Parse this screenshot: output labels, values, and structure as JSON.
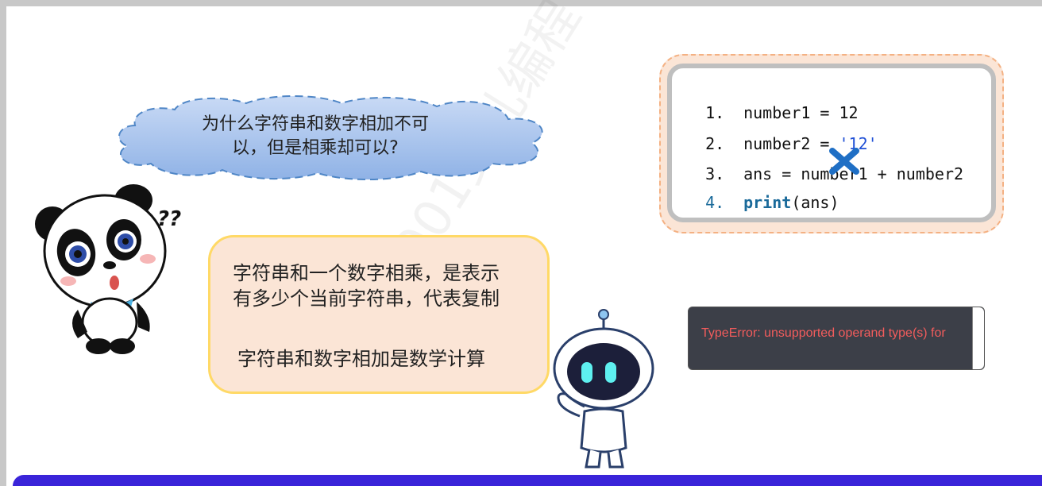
{
  "cloud": {
    "question_line1": "为什么字符串和数字相加不可",
    "question_line2": "以，但是相乘却可以?"
  },
  "panda": {
    "question_marks": "??"
  },
  "note": {
    "line1": "字符串和一个数字相乘，是表示",
    "line2": "有多少个当前字符串，代表复制",
    "line3": "字符串和数字相加是数学计算"
  },
  "code": {
    "lines": [
      {
        "num": "1.",
        "text": "number1 = 12"
      },
      {
        "num": "2.",
        "text": "number2 = ",
        "string": "'12'"
      },
      {
        "num": "3.",
        "text": "ans = number1 + number2"
      },
      {
        "num": "4.",
        "keyword": "print",
        "rest": "(ans)"
      }
    ]
  },
  "error": {
    "message": "TypeError: unsupported operand type(s) for"
  },
  "watermark": {
    "text": "001少儿编程"
  },
  "colors": {
    "accent_blue": "#3a24d9",
    "note_fill": "#fbe5d6",
    "note_border": "#ffd966",
    "code_frame_border": "#f4b183",
    "error_text": "#f25c5c",
    "xmark": "#1f6fc5"
  }
}
